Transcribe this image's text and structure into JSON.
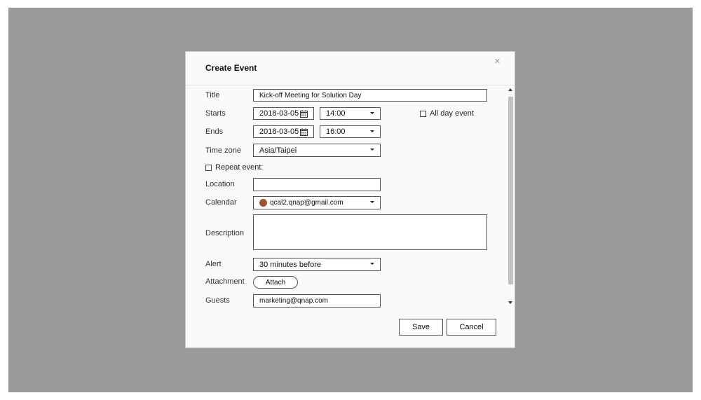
{
  "dialog": {
    "title": "Create Event",
    "close_symbol": "×"
  },
  "form": {
    "title_label": "Title",
    "title_value": "Kick-off Meeting for Solution Day",
    "starts_label": "Starts",
    "start_date": "2018-03-05",
    "start_time": "14:00",
    "all_day_label": "All day event",
    "ends_label": "Ends",
    "end_date": "2018-03-05",
    "end_time": "16:00",
    "timezone_label": "Time zone",
    "timezone_value": "Asia/Taipei",
    "repeat_label": "Repeat event:",
    "location_label": "Location",
    "location_value": "",
    "calendar_label": "Calendar",
    "calendar_value": "qcal2.qnap@gmail.com",
    "calendar_color": "#a0522d",
    "description_label": "Description",
    "description_value": "",
    "alert_label": "Alert",
    "alert_value": "30 minutes before",
    "attachment_label": "Attachment",
    "attach_button": "Attach",
    "guests_label": "Guests",
    "guests_value": "marketing@qnap.com"
  },
  "footer": {
    "save_label": "Save",
    "cancel_label": "Cancel"
  },
  "icons": {
    "calendar": "calendar-icon",
    "caret": "chevron-down-icon",
    "close": "close-icon"
  }
}
